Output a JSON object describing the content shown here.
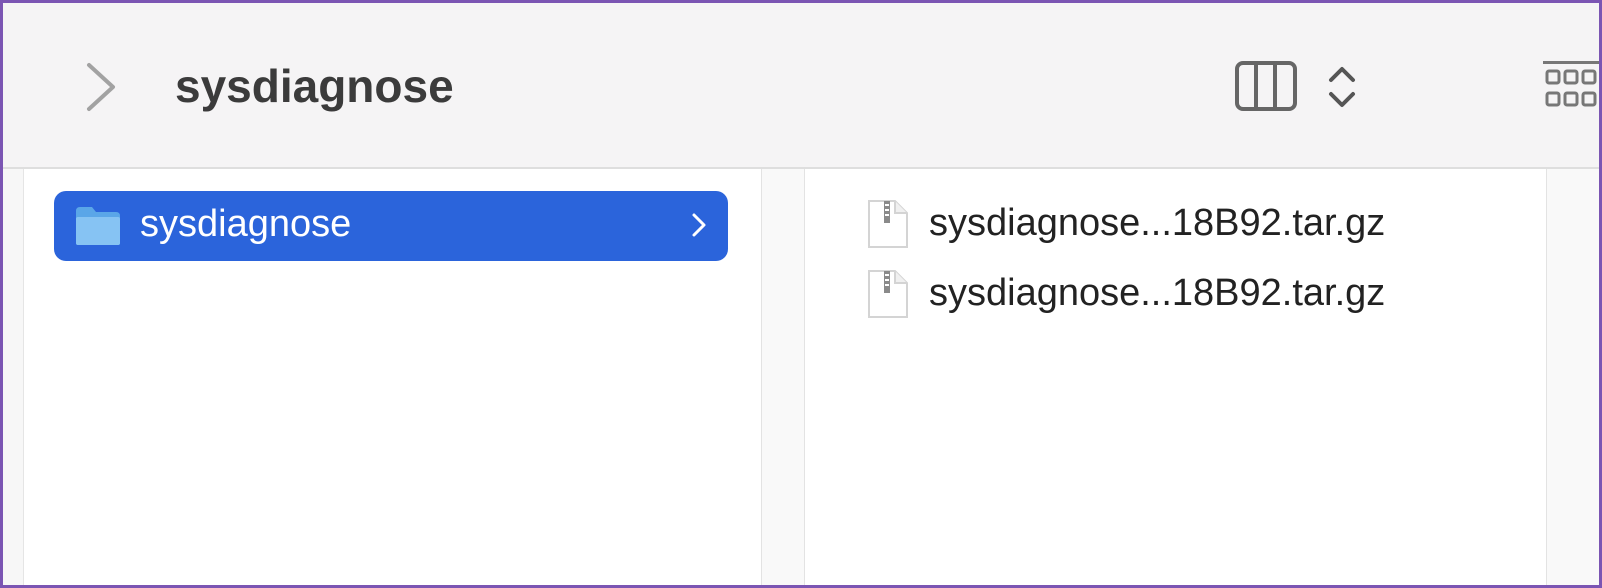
{
  "window": {
    "title": "sysdiagnose"
  },
  "toolbar": {
    "back_icon": "chevron-right-icon",
    "view_icon": "column-view-icon",
    "view_toggle_icon": "up-down-chevron-icon",
    "group_icon": "group-grid-icon"
  },
  "columns": [
    {
      "items": [
        {
          "label": "sysdiagnose",
          "icon": "folder-icon",
          "selected": true
        }
      ]
    },
    {
      "items": [
        {
          "label": "sysdiagnose...18B92.tar.gz",
          "icon": "archive-file-icon"
        },
        {
          "label": "sysdiagnose...18B92.tar.gz",
          "icon": "archive-file-icon"
        }
      ]
    }
  ],
  "colors": {
    "selection": "#2b64db",
    "frame": "#7b55b3",
    "folder": "#68b6ef"
  }
}
